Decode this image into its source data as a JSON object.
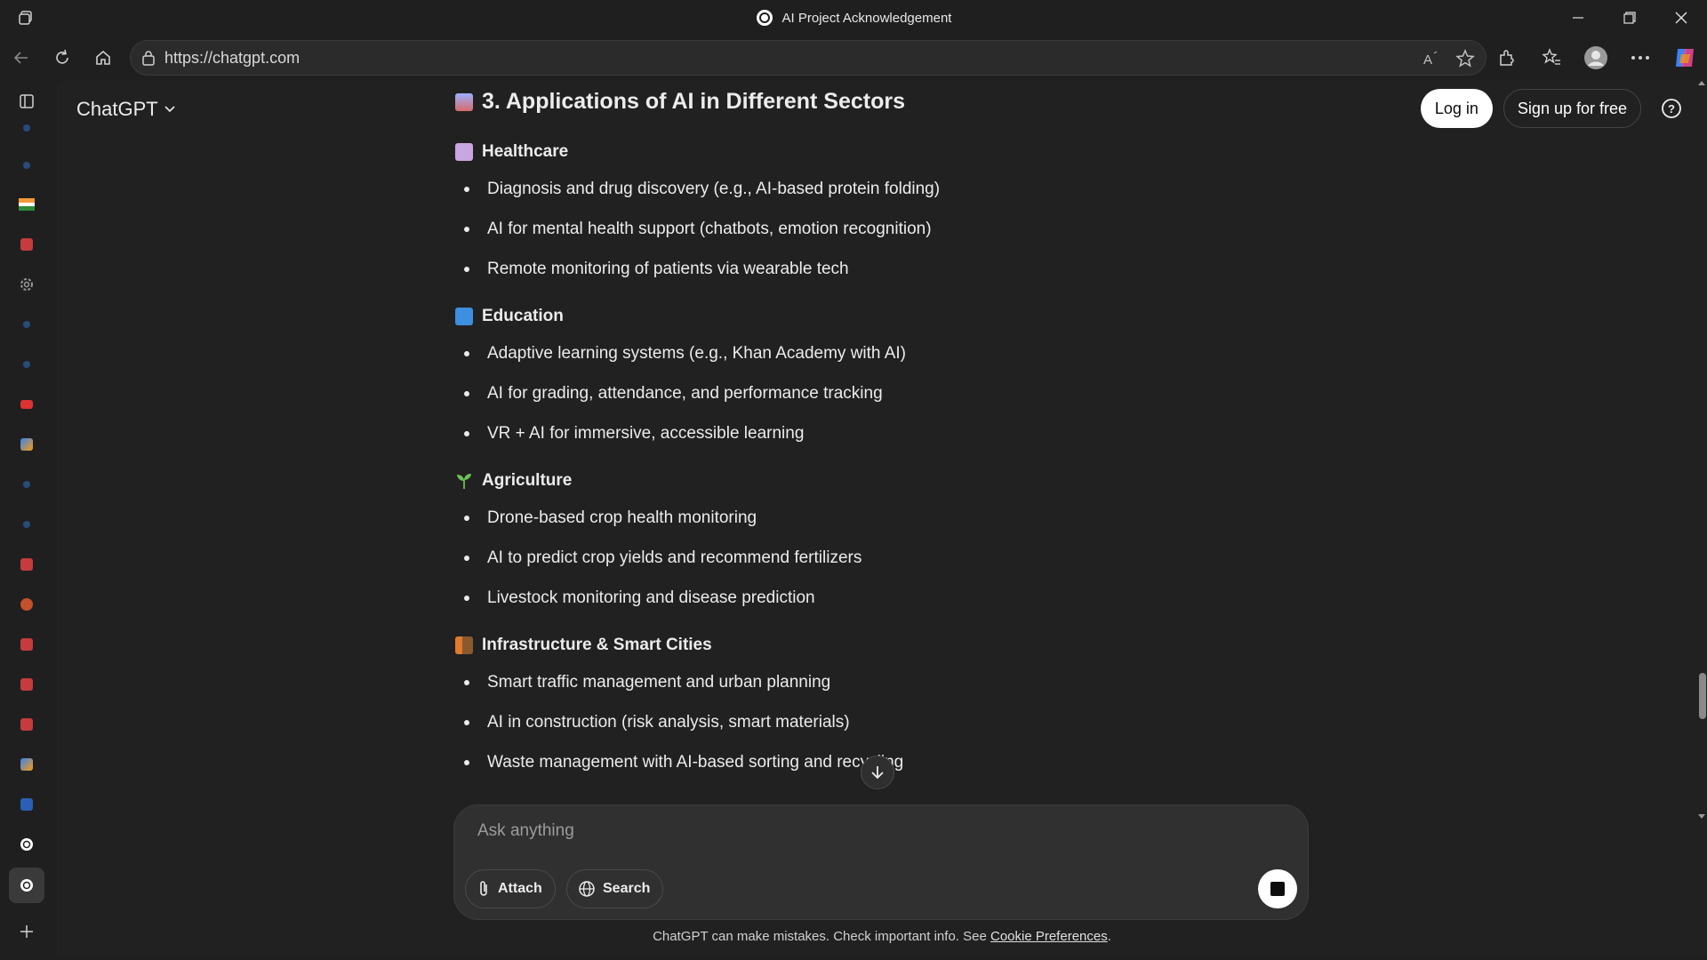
{
  "window": {
    "title": "AI Project Acknowledgement"
  },
  "browser": {
    "url": "https://chatgpt.com"
  },
  "header": {
    "brand": "ChatGPT",
    "login_label": "Log in",
    "signup_label": "Sign up for free"
  },
  "article": {
    "heading": "3. Applications of AI in Different Sectors",
    "sections": [
      {
        "title": "Healthcare",
        "items": [
          "Diagnosis and drug discovery (e.g., AI-based protein folding)",
          "AI for mental health support (chatbots, emotion recognition)",
          "Remote monitoring of patients via wearable tech"
        ]
      },
      {
        "title": "Education",
        "items": [
          "Adaptive learning systems (e.g., Khan Academy with AI)",
          "AI for grading, attendance, and performance tracking",
          "VR + AI for immersive, accessible learning"
        ]
      },
      {
        "title": "Agriculture",
        "items": [
          "Drone-based crop health monitoring",
          "AI to predict crop yields and recommend fertilizers",
          "Livestock monitoring and disease prediction"
        ]
      },
      {
        "title": "Infrastructure & Smart Cities",
        "items": [
          "Smart traffic management and urban planning",
          "AI in construction (risk analysis, smart materials)",
          "Waste management with AI-based sorting and recycling"
        ]
      }
    ]
  },
  "composer": {
    "placeholder": "Ask anything",
    "attach_label": "Attach",
    "search_label": "Search"
  },
  "footer": {
    "disclaimer": "ChatGPT can make mistakes. Check important info. See ",
    "link": "Cookie Preferences",
    "end": "."
  },
  "colors": {
    "page_bg": "#212121",
    "chrome_bg": "#1f1f1f",
    "composer_bg": "#303030",
    "text": "#ececec"
  }
}
